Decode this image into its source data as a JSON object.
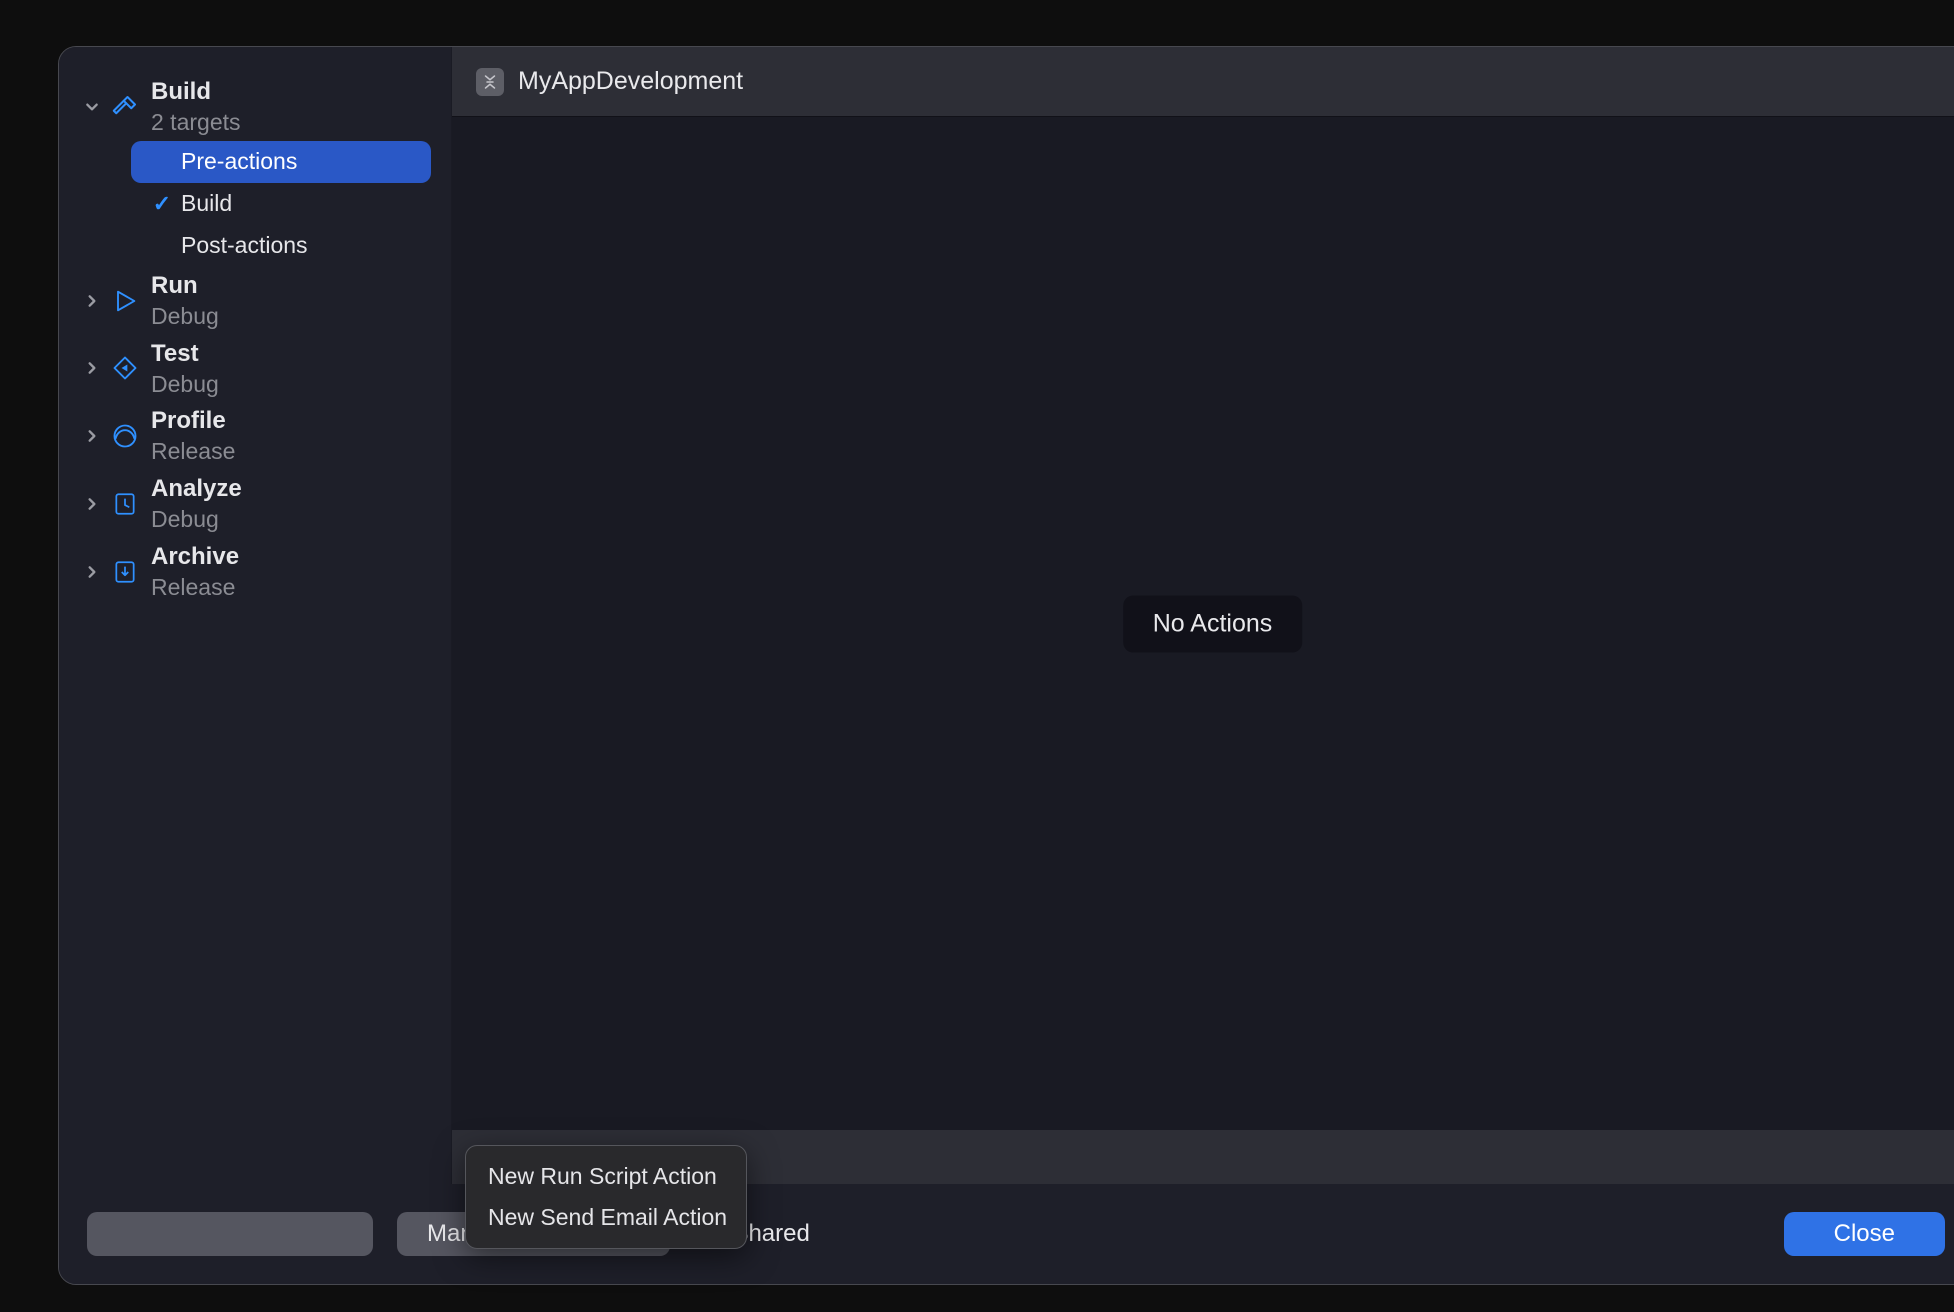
{
  "header": {
    "scheme_name": "MyAppDevelopment"
  },
  "sidebar": {
    "sections": [
      {
        "title": "Build",
        "subtitle": "2 targets",
        "expanded": true,
        "children": [
          {
            "label": "Pre-actions",
            "selected": true,
            "checked": false
          },
          {
            "label": "Build",
            "selected": false,
            "checked": true
          },
          {
            "label": "Post-actions",
            "selected": false,
            "checked": false
          }
        ]
      },
      {
        "title": "Run",
        "subtitle": "Debug",
        "expanded": false
      },
      {
        "title": "Test",
        "subtitle": "Debug",
        "expanded": false
      },
      {
        "title": "Profile",
        "subtitle": "Release",
        "expanded": false
      },
      {
        "title": "Analyze",
        "subtitle": "Debug",
        "expanded": false
      },
      {
        "title": "Archive",
        "subtitle": "Release",
        "expanded": false
      }
    ]
  },
  "content": {
    "empty_label": "No Actions"
  },
  "popup": {
    "items": [
      "New Run Script Action",
      "New Send Email Action"
    ]
  },
  "footer": {
    "manage_label": "Manage Schemes...",
    "shared_label": "Shared",
    "close_label": "Close"
  }
}
